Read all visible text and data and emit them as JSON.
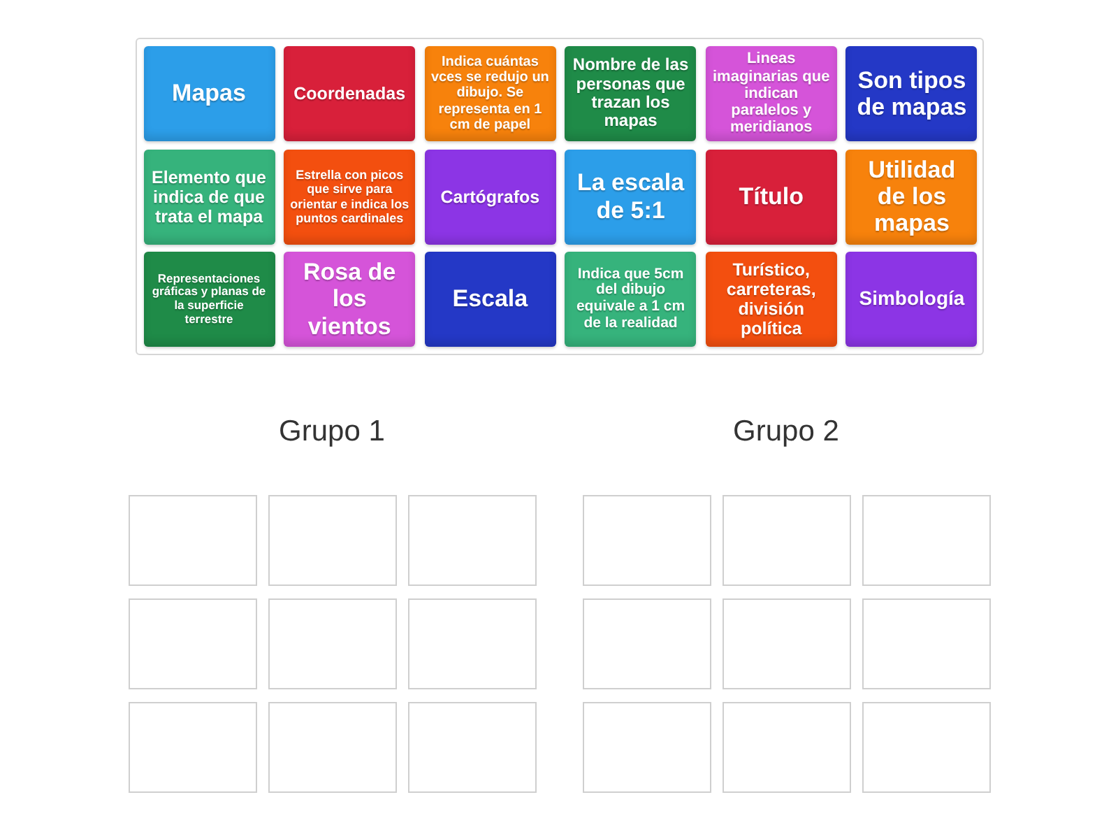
{
  "tiles": [
    {
      "text": "Mapas",
      "color": "#2c9ee9"
    },
    {
      "text": "Coordenadas",
      "color": "#d8203a"
    },
    {
      "text": "Indica cuántas vces se redujo un dibujo. Se representa en 1 cm de papel",
      "color": "#f7820c"
    },
    {
      "text": "Nombre de las personas que trazan los mapas",
      "color": "#1f8b48"
    },
    {
      "text": "Lineas imaginarias que indican paralelos y meridianos",
      "color": "#d554d9"
    },
    {
      "text": "Son tipos de mapas",
      "color": "#2438c6"
    },
    {
      "text": "Elemento que indica de que trata el mapa",
      "color": "#36b37c"
    },
    {
      "text": "Estrella con picos que sirve para orientar e indica los puntos cardinales",
      "color": "#f34f0f"
    },
    {
      "text": "Cartógrafos",
      "color": "#8c35e5"
    },
    {
      "text": "La escala de 5:1",
      "color": "#2c9ee9"
    },
    {
      "text": "Título",
      "color": "#d8203a"
    },
    {
      "text": "Utilidad de los mapas",
      "color": "#f7820c"
    },
    {
      "text": "Representaciones gráficas y planas de la superficie terrestre",
      "color": "#1f8b48"
    },
    {
      "text": "Rosa de los vientos",
      "color": "#d554d9"
    },
    {
      "text": "Escala",
      "color": "#2438c6"
    },
    {
      "text": "Indica que 5cm del dibujo equivale a 1 cm de la realidad",
      "color": "#36b37c"
    },
    {
      "text": "Turístico, carreteras, división política",
      "color": "#f34f0f"
    },
    {
      "text": "Simbología",
      "color": "#8c35e5"
    }
  ],
  "groups": [
    {
      "title": "Grupo 1"
    },
    {
      "title": "Grupo 2"
    }
  ]
}
